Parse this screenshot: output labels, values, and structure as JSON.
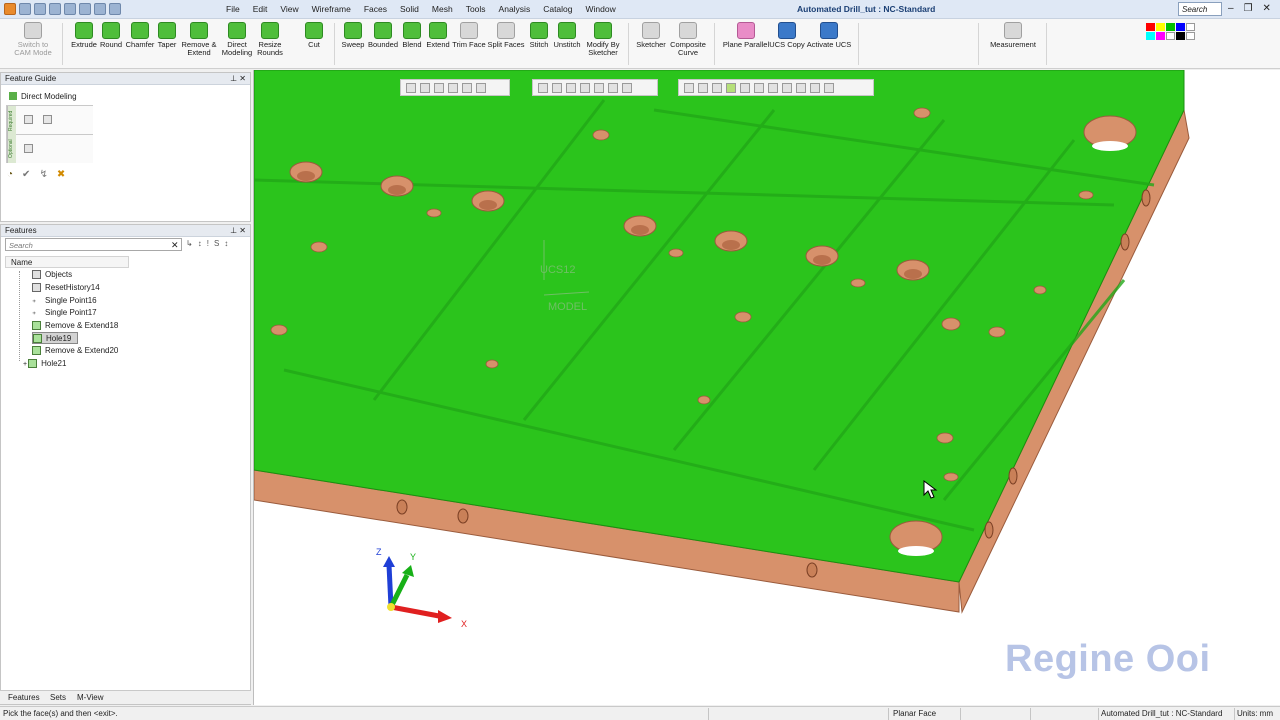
{
  "menu": [
    "File",
    "Edit",
    "View",
    "Wireframe",
    "Faces",
    "Solid",
    "Mesh",
    "Tools",
    "Analysis",
    "Catalog",
    "Window"
  ],
  "window_title": "Automated Drill_tut : NC-Standard",
  "search_placeholder": "Search",
  "ribbon": {
    "cam_mode": "Switch to CAM Mode",
    "extrude": "Extrude",
    "round": "Round",
    "chamfer": "Chamfer",
    "taper": "Taper",
    "remove_extend": "Remove & Extend",
    "direct_modeling": "Direct Modeling",
    "resize_rounds": "Resize Rounds",
    "cut": "Cut",
    "sweep": "Sweep",
    "bounded": "Bounded",
    "blend": "Blend",
    "extend": "Extend",
    "trim_face": "Trim Face",
    "split_faces": "Split Faces",
    "stitch": "Stitch",
    "unstitch": "Unstitch",
    "modify_by_sketcher": "Modify By Sketcher",
    "sketcher": "Sketcher",
    "composite_curve": "Composite Curve",
    "plane_parallel": "Plane Parallel",
    "ucs_copy": "UCS Copy",
    "activate_ucs": "Activate UCS",
    "measurement": "Measurement"
  },
  "feature_guide": {
    "title": "Feature Guide",
    "direct_modeling": "Direct Modeling",
    "required": "Required",
    "optional": "Optional"
  },
  "features_panel": {
    "title": "Features",
    "search_placeholder": "Search",
    "name_header": "Name",
    "items": [
      {
        "label": "Objects"
      },
      {
        "label": "ResetHistory14"
      },
      {
        "label": "Single Point16"
      },
      {
        "label": "Single Point17"
      },
      {
        "label": "Remove & Extend18"
      },
      {
        "label": "Hole19"
      },
      {
        "label": "Remove & Extend20"
      },
      {
        "label": "Hole21"
      }
    ],
    "tabs": [
      "Features",
      "Sets",
      "M-View"
    ]
  },
  "viewport": {
    "ucs_label": "UCS12",
    "model_label": "MODEL",
    "axis_x": "X",
    "axis_y": "Y",
    "axis_z": "Z",
    "watermark": "Regine Ooi"
  },
  "status": {
    "prompt": "Pick the face(s) and then <exit>.",
    "face_type": "Planar Face",
    "doc": "Automated Drill_tut : NC-Standard",
    "units": "Units: mm"
  },
  "colors": {
    "face_green": "#2bc41c",
    "copper": "#d7916b",
    "watermark": "#b7c4e6"
  }
}
